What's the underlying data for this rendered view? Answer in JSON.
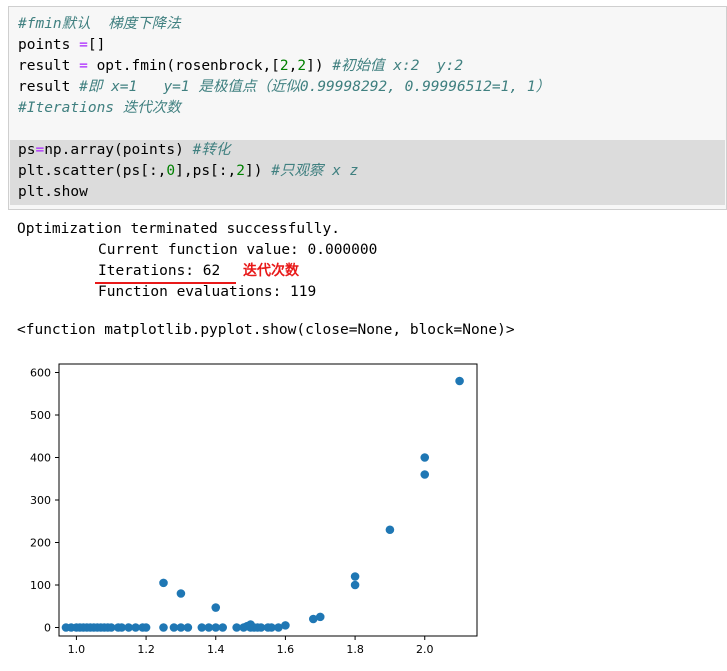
{
  "code": {
    "l1": "#fmin默认  梯度下降法",
    "l2a": "points ",
    "l2b": "=",
    "l2c": "[]",
    "l3a": "result ",
    "l3b": "=",
    "l3c": " opt.fmin(rosenbrock,[",
    "l3d": "2",
    "l3e": ",",
    "l3f": "2",
    "l3g": "]) ",
    "l3h": "#初始值 x:2  y:2",
    "l4a": "result ",
    "l4b": "#即 x=1   y=1 是极值点（近似0.99998292, 0.99996512=1, 1）",
    "l5": "#Iterations 迭代次数",
    "l6a": "ps",
    "l6b": "=",
    "l6c": "np.array(points) ",
    "l6d": "#转化",
    "l7a": "plt.scatter(ps[:,",
    "l7b": "0",
    "l7c": "],ps[:,",
    "l7d": "2",
    "l7e": "]) ",
    "l7f": "#只观察 x z",
    "l8": "plt.show"
  },
  "output": {
    "line1": "Optimization terminated successfully.",
    "line2": "Current function value: 0.000000",
    "line3": "Iterations: 62",
    "line4": "Function evaluations: 119",
    "annotation": "迭代次数",
    "repr": "<function matplotlib.pyplot.show(close=None, block=None)>"
  },
  "colors": {
    "point": "#1f77b4",
    "annotation": "#e81919",
    "comment": "#408080"
  },
  "chart_data": {
    "type": "scatter",
    "xlim": [
      0.95,
      2.15
    ],
    "ylim": [
      -20,
      620
    ],
    "xticks": [
      1.0,
      1.2,
      1.4,
      1.6,
      1.8,
      2.0
    ],
    "yticks": [
      0,
      100,
      200,
      300,
      400,
      500,
      600
    ],
    "x": [
      0.97,
      0.985,
      1.0,
      1.01,
      1.02,
      1.03,
      1.04,
      1.05,
      1.06,
      1.07,
      1.08,
      1.09,
      1.1,
      1.12,
      1.13,
      1.15,
      1.17,
      1.19,
      1.2,
      1.25,
      1.25,
      1.28,
      1.3,
      1.3,
      1.32,
      1.36,
      1.38,
      1.4,
      1.4,
      1.42,
      1.46,
      1.48,
      1.49,
      1.5,
      1.5,
      1.51,
      1.52,
      1.53,
      1.55,
      1.56,
      1.58,
      1.6,
      1.68,
      1.7,
      1.8,
      1.8,
      1.9,
      2.0,
      2.0,
      2.1
    ],
    "y": [
      0,
      0,
      0,
      0,
      0,
      0,
      0,
      0,
      0,
      0,
      0,
      0,
      0,
      0,
      0,
      0,
      0,
      0,
      0,
      0,
      105,
      0,
      0,
      80,
      0,
      0,
      0,
      0,
      47,
      0,
      0,
      0,
      3,
      0,
      7,
      0,
      0,
      0,
      0,
      0,
      0,
      5,
      20,
      25,
      100,
      120,
      230,
      360,
      400,
      580
    ],
    "grid": false,
    "title": "",
    "xlabel": "",
    "ylabel": ""
  }
}
